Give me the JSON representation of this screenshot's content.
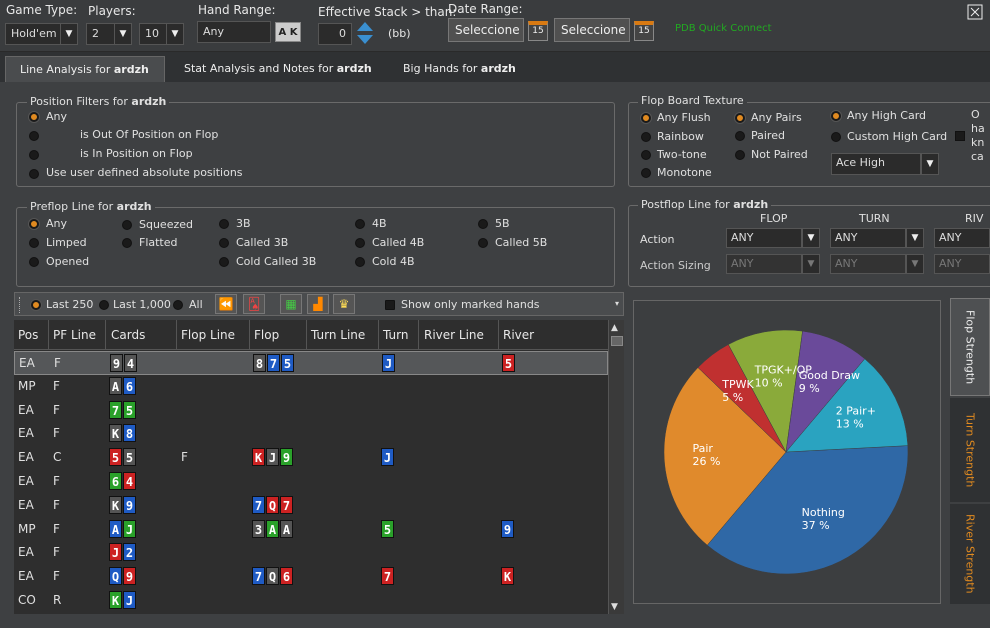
{
  "filters": {
    "game_type_label": "Game Type:",
    "game_type_value": "Hold'em",
    "players_label": "Players:",
    "players_min": "2",
    "players_max": "10",
    "hand_range_label": "Hand Range:",
    "hand_range_value": "Any",
    "hand_range_btn": "A K",
    "eff_stack_label": "Effective Stack > than:",
    "eff_stack_value": "0",
    "eff_stack_unit": "(bb)",
    "date_range_label": "Date Range:",
    "date_from": "Seleccione ur",
    "date_to": "Seleccione ur",
    "cal_day": "15",
    "status_text": "PDB Quick Connect",
    "status_color": "#22aa22"
  },
  "tabs": [
    {
      "label": "Line Analysis for ",
      "player": "ardzh"
    },
    {
      "label": "Stat Analysis and Notes for ",
      "player": "ardzh"
    },
    {
      "label": "Big Hands for ",
      "player": "ardzh"
    }
  ],
  "position_filters": {
    "title": "Position Filters for ",
    "player": "ardzh",
    "options": [
      "Any",
      "is Out Of Position on Flop",
      "is In Position on Flop",
      "Use user defined absolute positions"
    ]
  },
  "flop_texture": {
    "title": "Flop Board Texture",
    "col1": [
      "Any Flush",
      "Rainbow",
      "Two-tone",
      "Monotone"
    ],
    "col2": [
      "Any Pairs",
      "Paired",
      "Not Paired"
    ],
    "col3": [
      "Any High Card",
      "Custom High Card"
    ],
    "high_card_select": "Ace High",
    "clipped_text": [
      "O",
      "ha",
      "kn",
      "ca"
    ]
  },
  "preflop": {
    "title": "Preflop Line for ",
    "player": "ardzh",
    "options": [
      [
        "Any",
        "Limped",
        "Opened"
      ],
      [
        "Squeezed",
        "Flatted"
      ],
      [
        "3B",
        "Called 3B",
        "Cold Called 3B"
      ],
      [
        "4B",
        "Called 4B",
        "Cold 4B"
      ],
      [
        "5B",
        "Called 5B"
      ]
    ]
  },
  "postflop": {
    "title": "Postflop Line for ",
    "player": "ardzh",
    "cols": [
      "FLOP",
      "TURN",
      "RIV"
    ],
    "action_label": "Action",
    "sizing_label": "Action Sizing",
    "any": "ANY"
  },
  "toolbar": {
    "last250": "Last 250",
    "last1000": "Last 1,000",
    "all": "All",
    "marked": "Show only marked hands"
  },
  "grid": {
    "headers": [
      "Pos",
      "PF Line",
      "Cards",
      "Flop Line",
      "Flop",
      "Turn Line",
      "Turn",
      "River Line",
      "River"
    ],
    "rows": [
      {
        "pos": "EA",
        "pf": "F",
        "cards": [
          [
            "9",
            "s"
          ],
          [
            "4",
            "s"
          ]
        ],
        "flopline": "",
        "flop": [
          [
            "8",
            "s"
          ],
          [
            "7",
            "d"
          ],
          [
            "5",
            "d"
          ]
        ],
        "turn": [
          [
            "J",
            "d"
          ]
        ],
        "river": [
          [
            "5",
            "h"
          ]
        ]
      },
      {
        "pos": "MP",
        "pf": "F",
        "cards": [
          [
            "A",
            "s"
          ],
          [
            "6",
            "d"
          ]
        ],
        "flopline": "",
        "flop": [],
        "turn": [],
        "river": []
      },
      {
        "pos": "EA",
        "pf": "F",
        "cards": [
          [
            "7",
            "c"
          ],
          [
            "5",
            "c"
          ]
        ],
        "flopline": "",
        "flop": [],
        "turn": [],
        "river": []
      },
      {
        "pos": "EA",
        "pf": "F",
        "cards": [
          [
            "K",
            "s"
          ],
          [
            "8",
            "d"
          ]
        ],
        "flopline": "",
        "flop": [],
        "turn": [],
        "river": []
      },
      {
        "pos": "EA",
        "pf": "C",
        "cards": [
          [
            "5",
            "h"
          ],
          [
            "5",
            "s"
          ]
        ],
        "flopline": "F",
        "flop": [
          [
            "K",
            "h"
          ],
          [
            "J",
            "s"
          ],
          [
            "9",
            "c"
          ]
        ],
        "turn": [
          [
            "J",
            "d"
          ]
        ],
        "river": []
      },
      {
        "pos": "EA",
        "pf": "F",
        "cards": [
          [
            "6",
            "c"
          ],
          [
            "4",
            "h"
          ]
        ],
        "flopline": "",
        "flop": [],
        "turn": [],
        "river": []
      },
      {
        "pos": "EA",
        "pf": "F",
        "cards": [
          [
            "K",
            "s"
          ],
          [
            "9",
            "d"
          ]
        ],
        "flopline": "",
        "flop": [
          [
            "7",
            "d"
          ],
          [
            "Q",
            "h"
          ],
          [
            "7",
            "h"
          ]
        ],
        "turn": [],
        "river": []
      },
      {
        "pos": "MP",
        "pf": "F",
        "cards": [
          [
            "A",
            "d"
          ],
          [
            "J",
            "c"
          ]
        ],
        "flopline": "",
        "flop": [
          [
            "3",
            "s"
          ],
          [
            "A",
            "c"
          ],
          [
            "A",
            "s"
          ]
        ],
        "turn": [
          [
            "5",
            "c"
          ]
        ],
        "river": [
          [
            "9",
            "d"
          ]
        ]
      },
      {
        "pos": "EA",
        "pf": "F",
        "cards": [
          [
            "J",
            "h"
          ],
          [
            "2",
            "d"
          ]
        ],
        "flopline": "",
        "flop": [],
        "turn": [],
        "river": []
      },
      {
        "pos": "EA",
        "pf": "F",
        "cards": [
          [
            "Q",
            "d"
          ],
          [
            "9",
            "h"
          ]
        ],
        "flopline": "",
        "flop": [
          [
            "7",
            "d"
          ],
          [
            "Q",
            "s"
          ],
          [
            "6",
            "h"
          ]
        ],
        "turn": [
          [
            "7",
            "h"
          ]
        ],
        "river": [
          [
            "K",
            "h"
          ]
        ]
      },
      {
        "pos": "CO",
        "pf": "R",
        "cards": [
          [
            "K",
            "c"
          ],
          [
            "J",
            "d"
          ]
        ],
        "flopline": "",
        "flop": [],
        "turn": [],
        "river": []
      }
    ]
  },
  "chart_data": {
    "type": "pie",
    "slices": [
      {
        "label": "Nothing",
        "value": 37,
        "color": "#2f68a6"
      },
      {
        "label": "Pair",
        "value": 26,
        "color": "#e08a2c"
      },
      {
        "label": "TPWK",
        "value": 5,
        "color": "#c03030"
      },
      {
        "label": "TPGK+/OP",
        "value": 10,
        "color": "#8aaa3a"
      },
      {
        "label": "Good Draw",
        "value": 9,
        "color": "#6a4a9a"
      },
      {
        "label": "2 Pair+",
        "value": 13,
        "color": "#2aa3c0"
      }
    ]
  },
  "side_tabs": [
    "Flop Strength",
    "Turn Strength",
    "River Strength"
  ]
}
